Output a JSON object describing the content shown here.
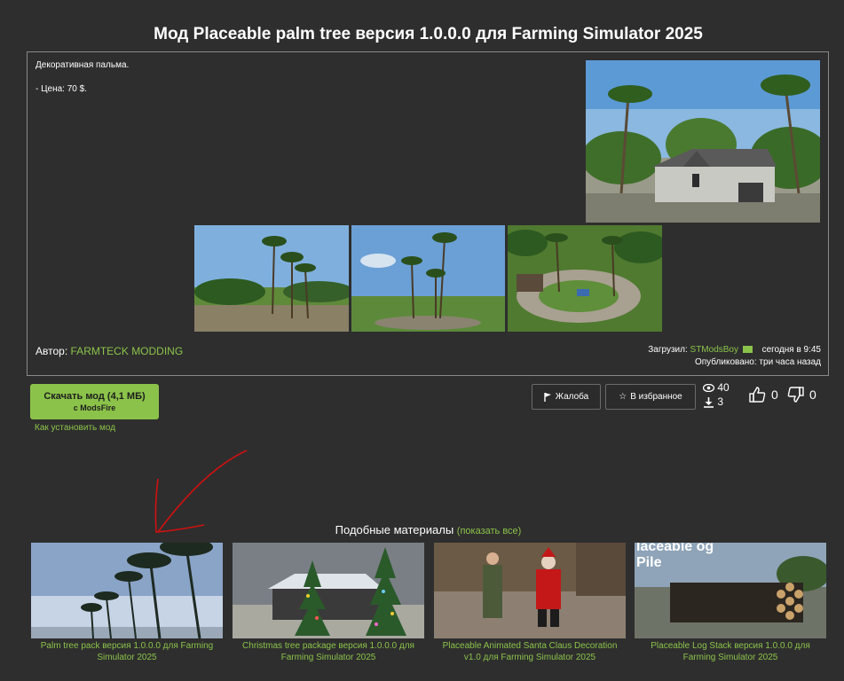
{
  "title": "Мод Placeable palm tree версия 1.0.0.0 для Farming Simulator 2025",
  "description": {
    "line1": "Декоративная пальма.",
    "line2": "- Цена: 70 $."
  },
  "author": {
    "label": "Автор:",
    "name": "FARMTECK MODDING"
  },
  "upload": {
    "label": "Загрузил:",
    "user": "STModsBoy",
    "time": "сегодня в 9:45",
    "published": "Опубликовано: три часа назад"
  },
  "download": {
    "label": "Скачать мод (4,1 МБ)",
    "sub": "с ModsFire",
    "howto": "Как установить мод"
  },
  "actions": {
    "report": "Жалоба",
    "favorite": "В избранное"
  },
  "stats": {
    "views": "40",
    "downloads": "3",
    "likes": "0",
    "dislikes": "0"
  },
  "similar": {
    "title": "Подобные материалы",
    "show_all": "(показать все)",
    "items": [
      {
        "caption": "Palm tree pack версия 1.0.0.0 для Farming Simulator 2025"
      },
      {
        "caption": "Christmas tree package версия 1.0.0.0 для Farming Simulator 2025"
      },
      {
        "caption": "Placeable Animated Santa Claus Decoration v1.0 для Farming Simulator 2025"
      },
      {
        "caption": "Placeable Log Stack версия 1.0.0.0 для Farming Simulator 2025",
        "overlay": "laceable og Pile"
      }
    ]
  },
  "colors": {
    "accent": "#8bc34a",
    "background": "#2e2e2e",
    "arrow": "#d01010"
  }
}
